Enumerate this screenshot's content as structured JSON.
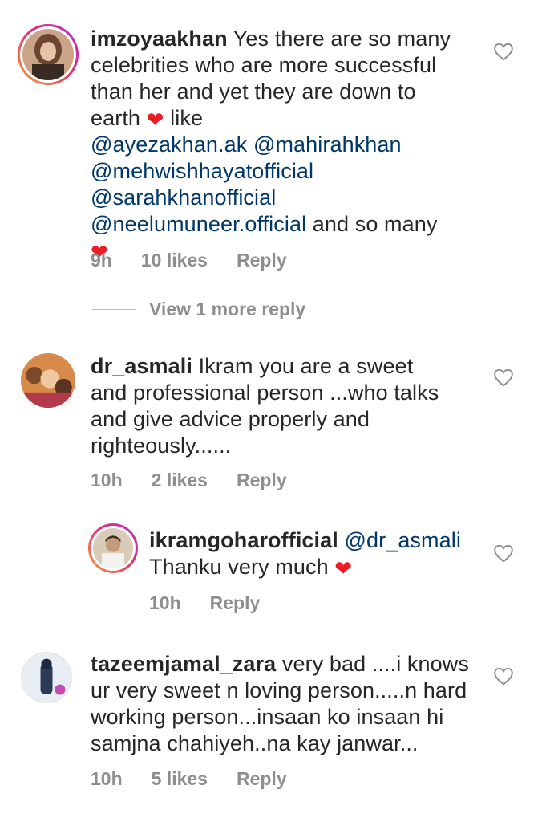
{
  "comments": [
    {
      "username": "imzoyaakhan",
      "text_before": "Yes there are so many celebrities who are more successful than her and yet they are down to earth ",
      "text_after_heart": " like ",
      "mentions": [
        "@ayezakhan.ak",
        "@mahirahkhan",
        "@mehwishhayatofficial",
        "@sarahkhanofficial",
        "@neelumuneer.official"
      ],
      "text_end": " and so many",
      "time": "9h",
      "likes": "10 likes",
      "reply": "Reply"
    },
    {
      "username": "dr_asmali",
      "text": "Ikram you are a sweet and professional person ...who talks and give advice properly and righteously......",
      "time": "10h",
      "likes": "2 likes",
      "reply": "Reply"
    },
    {
      "username": "ikramgoharofficial",
      "mention": "@dr_asmali",
      "text": "Thanku very much ",
      "time": "10h",
      "reply": "Reply"
    },
    {
      "username": "tazeemjamal_zara",
      "text": "very bad ....i knows ur very sweet n loving person.....n hard working person...insaan ko insaan hi samjna chahiyeh..na kay janwar...",
      "time": "10h",
      "likes": "5 likes",
      "reply": "Reply"
    }
  ],
  "view_more": "View 1 more reply",
  "icons": {
    "like": "heart-outline-icon",
    "emoji": "red-heart-emoji"
  },
  "colors": {
    "mention": "#00376b",
    "meta": "#8e8e8e",
    "text": "#262626",
    "emoji_heart": "#ed1c24"
  }
}
